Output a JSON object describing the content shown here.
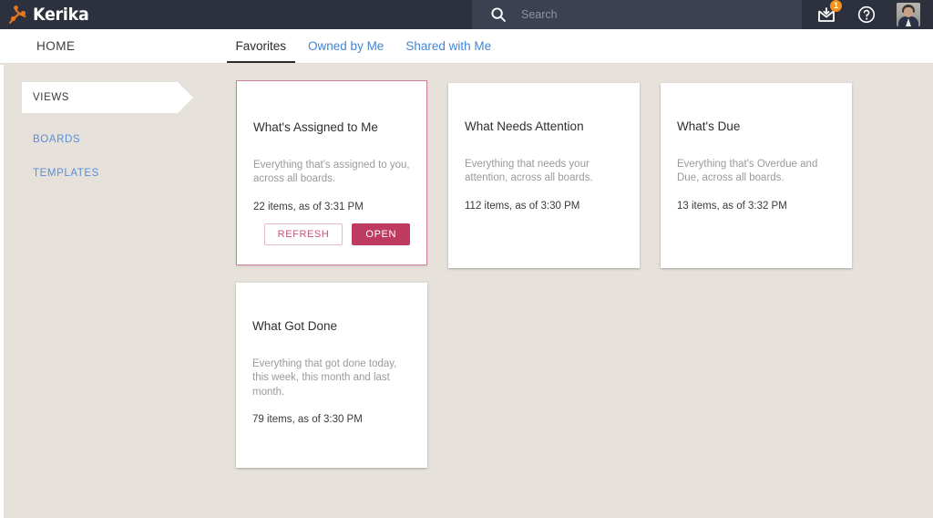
{
  "app": {
    "brand_name": "Kerika",
    "logo_icon": "kerika-runner-logo-icon"
  },
  "topbar": {
    "search": {
      "icon": "search-icon",
      "placeholder": "Search",
      "value": ""
    },
    "inbox": {
      "icon": "inbox-download-icon",
      "badge_count": "1",
      "badge_color": "#f2921d"
    },
    "help": {
      "icon": "question-circle-icon"
    },
    "avatar": {
      "icon": "user-avatar-photo"
    },
    "background_color": "#2c313d",
    "search_background_color": "#3b4150"
  },
  "navbar": {
    "home_label": "HOME",
    "tabs": [
      {
        "label": "Favorites",
        "active": true
      },
      {
        "label": "Owned by Me",
        "active": false
      },
      {
        "label": "Shared with Me",
        "active": false
      }
    ],
    "active_color": "#2c2c2c",
    "link_color": "#4285d6"
  },
  "sidebar": {
    "items": [
      {
        "label": "VIEWS",
        "selected": true
      },
      {
        "label": "BOARDS",
        "selected": false
      },
      {
        "label": "TEMPLATES",
        "selected": false
      }
    ]
  },
  "cards": [
    {
      "title": "What's Assigned to Me",
      "description": "Everything that's assigned to you, across all boards.",
      "count_text": "22 items, as of 3:31 PM",
      "selected": true,
      "buttons": {
        "refresh_label": "REFRESH",
        "open_label": "OPEN"
      }
    },
    {
      "title": "What Needs Attention",
      "description": "Everything that needs your attention, across all boards.",
      "count_text": "112 items, as of 3:30 PM",
      "selected": false
    },
    {
      "title": "What's Due",
      "description": "Everything that's Overdue and Due, across all boards.",
      "count_text": "13 items, as of 3:32 PM",
      "selected": false
    },
    {
      "title": "What Got Done",
      "description": "Everything that got done today, this week, this month and last month.",
      "count_text": "79 items, as of 3:30 PM",
      "selected": false
    }
  ],
  "theme": {
    "page_background": "#e6e1db",
    "accent_crimson": "#bf3a60",
    "accent_border": "#cf7f96",
    "accent_orange": "#f2921d"
  }
}
